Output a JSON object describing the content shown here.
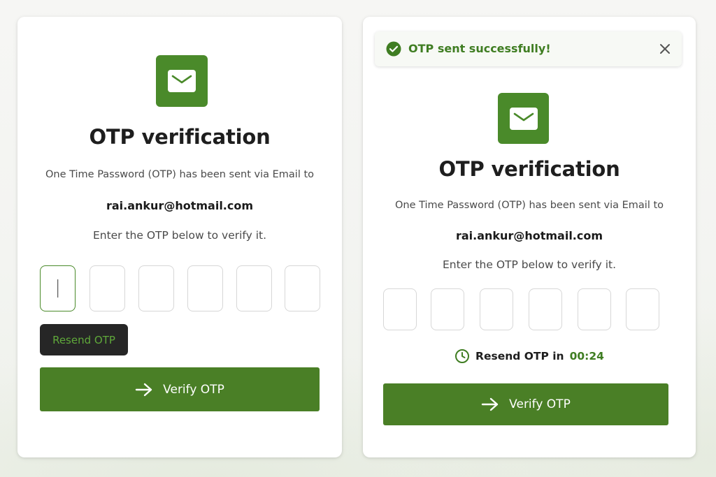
{
  "brand": {
    "accent": "#4a8a2a",
    "button_green": "#4a7f26",
    "text_green": "#3f7d22",
    "dark_button": "#262626"
  },
  "left_card": {
    "icon": "mail-icon",
    "title": "OTP verification",
    "sent_text": "One Time Password (OTP) has been sent via Email to",
    "email": "rai.ankur@hotmail.com",
    "instruction": "Enter the OTP below to verify it.",
    "otp_values": [
      "",
      "",
      "",
      "",
      "",
      ""
    ],
    "resend_label": "Resend OTP",
    "verify_label": "Verify OTP",
    "verify_icon": "arrow-right-icon"
  },
  "right_card": {
    "toast": {
      "icon": "check-circle-icon",
      "message": "OTP sent successfully!",
      "close_icon": "close-icon"
    },
    "icon": "mail-icon",
    "title": "OTP verification",
    "sent_text": "One Time Password (OTP) has been sent via Email to",
    "email": "rai.ankur@hotmail.com",
    "instruction": "Enter the OTP below to verify it.",
    "otp_values": [
      "",
      "",
      "",
      "",
      "",
      ""
    ],
    "resend_timer_label": "Resend OTP in",
    "resend_timer_value": "00:24",
    "timer_icon": "clock-icon",
    "verify_label": "Verify OTP",
    "verify_icon": "arrow-right-icon"
  }
}
